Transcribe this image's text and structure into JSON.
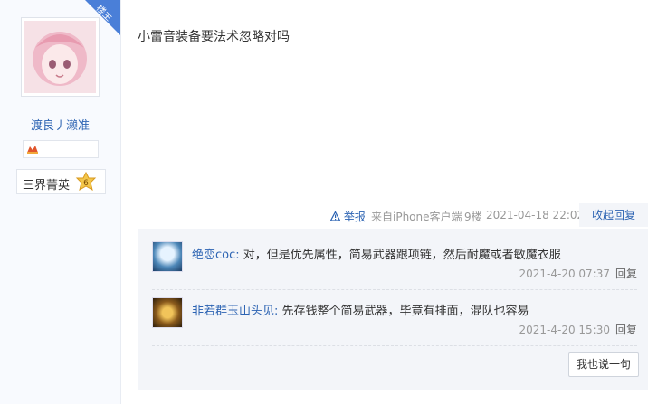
{
  "author": {
    "role_badge": "楼主",
    "name": "渡良丿濑准",
    "level_name": "三界菁英",
    "level_number": "6",
    "brand_color": "#2d64b3"
  },
  "post": {
    "content": "小雷音装备要法术忽略对吗",
    "report_label": "举报",
    "source": "来自iPhone客户端",
    "floor": "9楼",
    "datetime": "2021-04-18 22:02",
    "collapse_label": "收起回复"
  },
  "replies": [
    {
      "name": "绝恋coc:",
      "text": " 对，但是优先属性，简易武器跟项链，然后耐魔或者敏魔衣服",
      "time": "2021-4-20 07:37",
      "reply_label": "回复"
    },
    {
      "name": "非若群玉山头见:",
      "text": " 先存钱整个简易武器，毕竟有排面，混队也容易",
      "time": "2021-4-20 15:30",
      "reply_label": "回复"
    }
  ],
  "say_button_label": "我也说一句"
}
